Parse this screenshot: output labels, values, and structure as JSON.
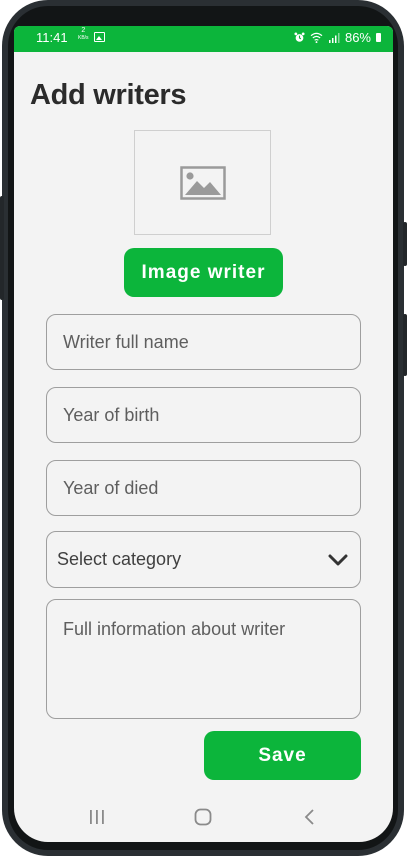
{
  "status_bar": {
    "time": "11:41",
    "speed_value": "2",
    "speed_unit": "KB/s",
    "battery": "86%"
  },
  "page": {
    "title": "Add writers"
  },
  "form": {
    "image_button_label": "Image writer",
    "name_placeholder": "Writer full name",
    "birth_placeholder": "Year of birth",
    "died_placeholder": "Year of died",
    "category_selected": "Select category",
    "info_placeholder": "Full information about writer",
    "save_label": "Save"
  },
  "icons": {
    "placeholder": "image-placeholder-icon",
    "dropdown": "chevron-down-icon",
    "nav_recents": "recents-icon",
    "nav_home": "home-icon",
    "nav_back": "back-icon"
  },
  "colors": {
    "accent": "#0cb53b",
    "background": "#f3f3f3",
    "title": "#2b2b2b"
  }
}
